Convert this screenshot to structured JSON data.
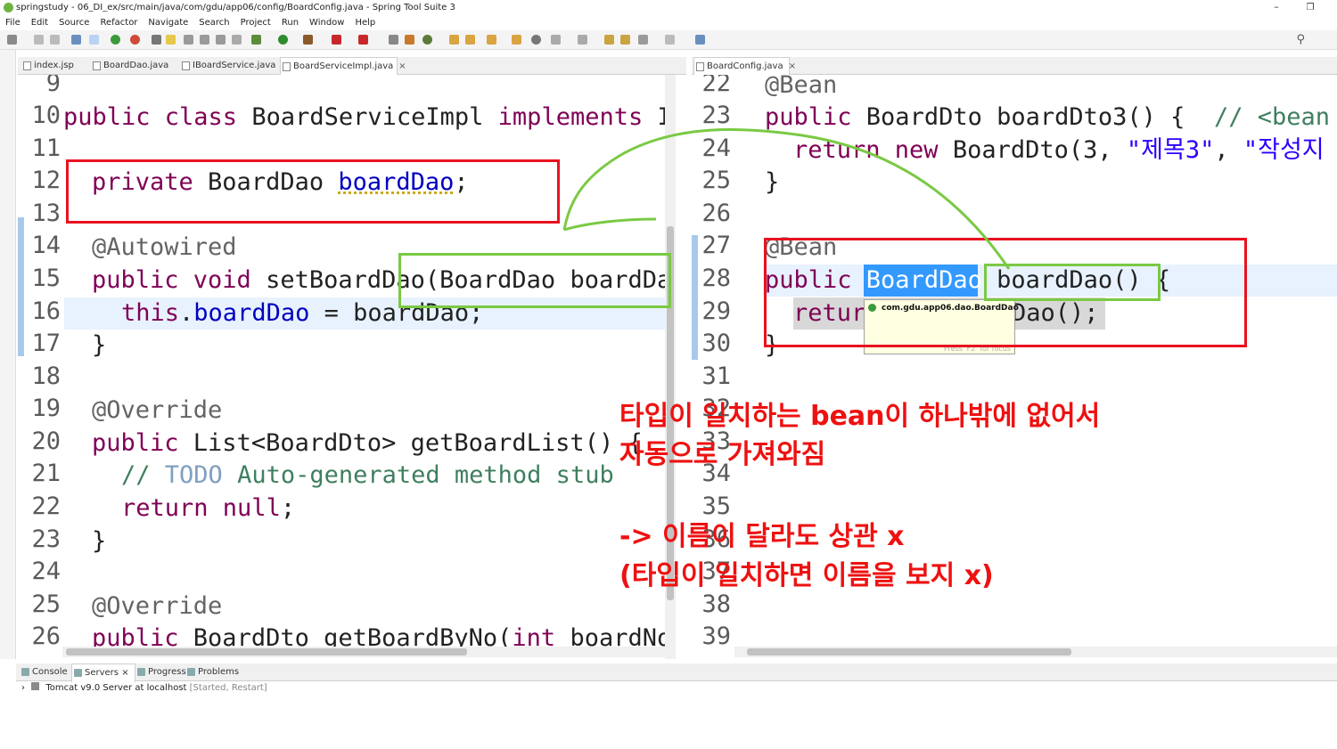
{
  "window": {
    "title": "springstudy - 06_DI_ex/src/main/java/com/gdu/app06/config/BoardConfig.java - Spring Tool Suite 3",
    "minimize": "–",
    "maximize": "❐"
  },
  "menu": [
    "File",
    "Edit",
    "Source",
    "Refactor",
    "Navigate",
    "Search",
    "Project",
    "Run",
    "Window",
    "Help"
  ],
  "left_tabs": [
    {
      "label": "index.jsp"
    },
    {
      "label": "BoardDao.java"
    },
    {
      "label": "IBoardService.java"
    },
    {
      "label": "BoardServiceImpl.java",
      "close": "×"
    }
  ],
  "right_tabs": [
    {
      "label": "BoardConfig.java",
      "close": "×"
    }
  ],
  "left_code": {
    "n9": "9",
    "n10": "10",
    "n11": "11",
    "n12": "12",
    "n13": "13",
    "n14": "14",
    "n15": "15",
    "n16": "16",
    "n17": "17",
    "n18": "18",
    "n19": "19",
    "n20": "20",
    "n21": "21",
    "n22": "22",
    "n23": "23",
    "n24": "24",
    "n25": "25",
    "n26": "26",
    "l10a": "public class ",
    "l10b": "BoardServiceImpl ",
    "l10c": "implements ",
    "l10d": "IE",
    "l12a": "private ",
    "l12b": "BoardDao ",
    "l12c": "boardDao",
    "l12d": ";",
    "l14": "@Autowired",
    "l15a": "public void ",
    "l15b": "setBoardDao(BoardDao boardDac",
    "l16a": "this",
    "l16b": ".",
    "l16c": "boardDao",
    "l16d": " = boardDao;",
    "l17": "}",
    "l19": "@Override",
    "l20a": "public ",
    "l20b": "List<BoardDto> getBoardList() {",
    "l21a": "// ",
    "l21b": "TODO",
    "l21c": " Auto-generated method stub",
    "l22a": "return ",
    "l22b": "null",
    "l22c": ";",
    "l23": "}",
    "l25": "@Override",
    "l26a": "public ",
    "l26b": "BoardDto getBoardByNo(",
    "l26c": "int ",
    "l26d": "boardNo)"
  },
  "right_code": {
    "n22": "22",
    "n23": "23",
    "n24": "24",
    "n25": "25",
    "n26": "26",
    "n27": "27",
    "n28": "28",
    "n29": "29",
    "n30": "30",
    "n31": "31",
    "n32": "32",
    "n33": "33",
    "n34": "34",
    "n35": "35",
    "n36": "36",
    "n37": "37",
    "n38": "38",
    "n39": "39",
    "l22": "@Bean",
    "l23a": "public ",
    "l23b": "BoardDto boardDto3() {  ",
    "l23c": "// <bean c",
    "l24a": "return new ",
    "l24b": "BoardDto(3, ",
    "l24c": "\"제목3\"",
    "l24d": ", ",
    "l24e": "\"작성지",
    "l25": "}",
    "l27": "@Bean",
    "l28a": "public ",
    "l28b": "BoardDao",
    "l28c": " boardDao() {",
    "l29a": "retur",
    "l29b": "Dao();",
    "l30": "}"
  },
  "tooltip": {
    "text": "com.gdu.app06.dao.BoardDao",
    "hint": "Press 'F2' for focus"
  },
  "annotations": {
    "line1": "타입이 일치하는 bean이 하나밖에 없어서",
    "line2": "자동으로 가져와짐",
    "line3": "-> 이름이 달라도 상관 x",
    "line4": "(타입이 일치하면 이름을 보지 x)"
  },
  "bottom_tabs": [
    {
      "label": "Console"
    },
    {
      "label": "Servers",
      "close": "×"
    },
    {
      "label": "Progress"
    },
    {
      "label": "Problems"
    }
  ],
  "server_row": {
    "name": "Tomcat v9.0 Server at localhost",
    "status": "[Started, Restart]"
  },
  "colors": {
    "keyword": "#7f0055",
    "field": "#0000c0",
    "annotation": "#646464",
    "comment": "#3f7f5f",
    "string": "#2a00ff",
    "red_box": "#e8121f",
    "green_box": "#7ac943",
    "note": "#ee1111"
  }
}
